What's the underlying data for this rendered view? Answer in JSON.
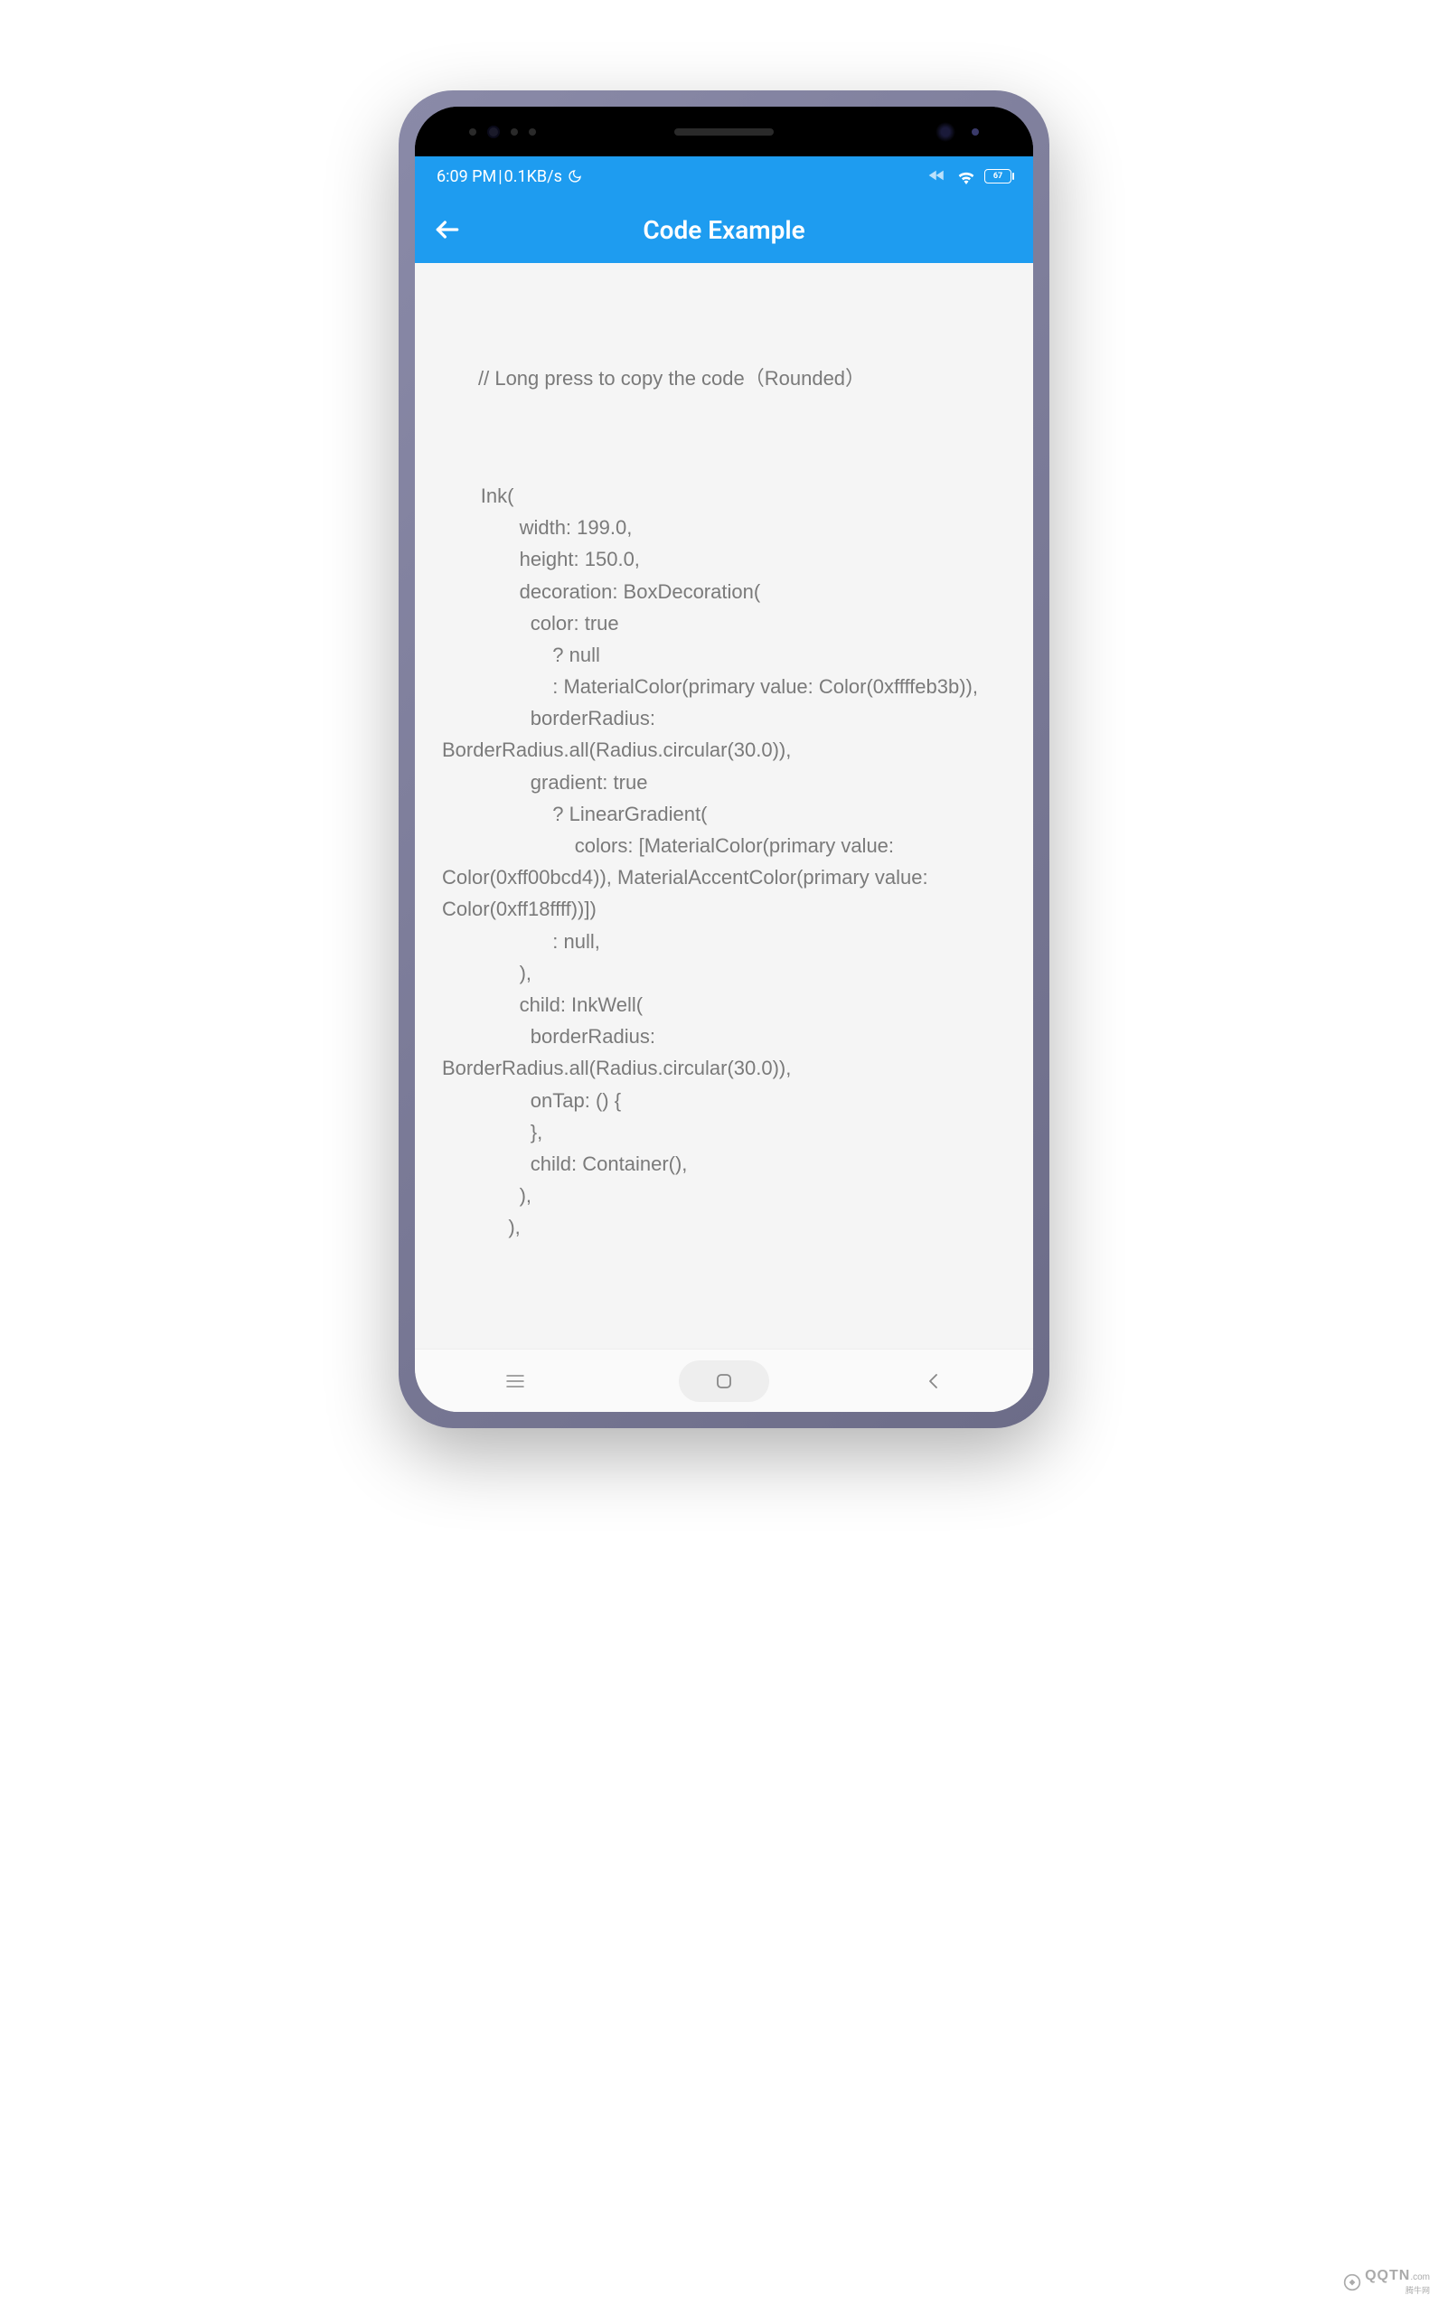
{
  "status_bar": {
    "time": "6:09 PM",
    "separator": " | ",
    "network_speed": "0.1KB/s",
    "battery_level": "67"
  },
  "app_bar": {
    "title": "Code Example"
  },
  "content": {
    "comment": "// Long press to copy the code（Rounded）",
    "code": "       Ink(\n              width: 199.0,\n              height: 150.0,\n              decoration: BoxDecoration(\n                color: true\n                    ? null\n                    : MaterialColor(primary value: Color(0xffffeb3b)),\n                borderRadius: BorderRadius.all(Radius.circular(30.0)),\n                gradient: true\n                    ? LinearGradient(\n                        colors: [MaterialColor(primary value: Color(0xff00bcd4)), MaterialAccentColor(primary value: Color(0xff18ffff))])\n                    : null,\n              ),\n              child: InkWell(\n                borderRadius: BorderRadius.all(Radius.circular(30.0)),\n                onTap: () {\n                },\n                child: Container(),\n              ),\n            ),"
  },
  "watermark": {
    "text": "QQTN",
    "suffix": ".com",
    "subtitle": "腾牛网"
  }
}
